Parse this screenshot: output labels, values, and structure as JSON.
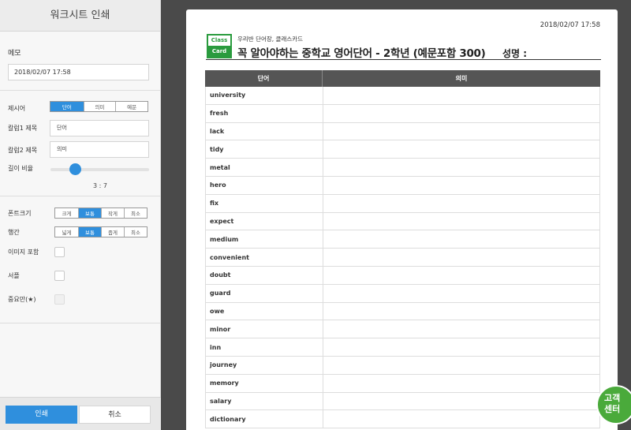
{
  "panel": {
    "title": "워크시트 인쇄",
    "memo_label": "메모",
    "memo_value": "2018/02/07 17:58",
    "prompt_label": "제시어",
    "prompt_options": [
      "단어",
      "의미",
      "예문"
    ],
    "prompt_selected": "단어",
    "col1_label": "칼럼1 제목",
    "col1_value": "단어",
    "col2_label": "칼럼2 제목",
    "col2_value": "의미",
    "length_label": "길이 비율",
    "length_ratio": "3 : 7",
    "length_ratio_fraction": 0.25,
    "fontsize_label": "폰트크기",
    "fontsize_options": [
      "크게",
      "보통",
      "작게",
      "최소"
    ],
    "fontsize_selected": "보통",
    "linespacing_label": "행간",
    "linespacing_options": [
      "넓게",
      "보통",
      "좁게",
      "최소"
    ],
    "linespacing_selected": "보통",
    "image_label": "이미지 포함",
    "signature_label": "서플",
    "important_label": "중요만(★)",
    "print_button": "인쇄",
    "cancel_button": "취소"
  },
  "paper": {
    "date": "2018/02/07 17:58",
    "logo_top": "Class",
    "logo_bottom": "Card",
    "subtitle": "우리반 단어장, 클래스카드",
    "title": "꼭 알아야하는 중학교 영어단어 - 2학년 (예문포함 300)",
    "name_label": "성명 :",
    "columns": [
      "단어",
      "의미"
    ],
    "words": [
      "university",
      "fresh",
      "lack",
      "tidy",
      "metal",
      "hero",
      "fix",
      "expect",
      "medium",
      "convenient",
      "doubt",
      "guard",
      "owe",
      "minor",
      "inn",
      "journey",
      "memory",
      "salary",
      "dictionary"
    ]
  },
  "help": {
    "line1": "고객",
    "line2": "센터"
  },
  "colors": {
    "accent": "#2f8fdd",
    "logo_green": "#2a9b3e",
    "header_gray": "#555555"
  }
}
